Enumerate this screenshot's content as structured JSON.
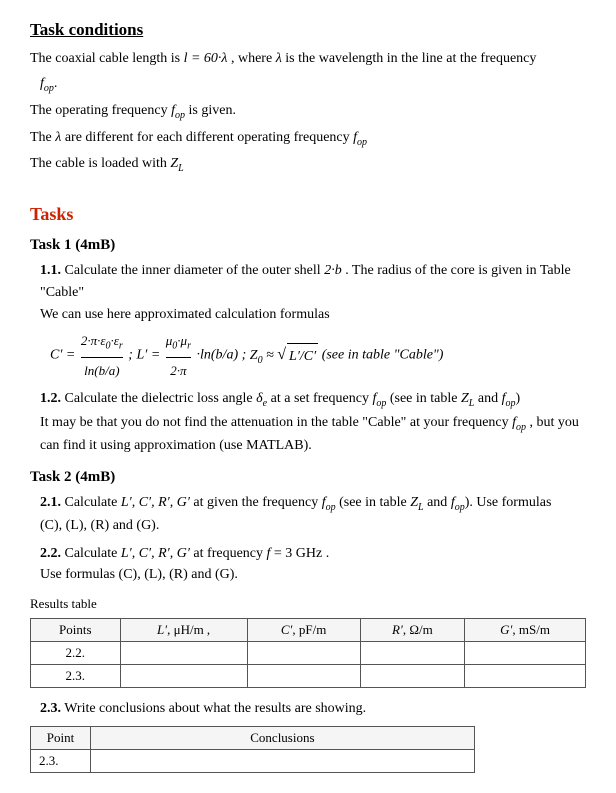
{
  "title": "Task conditions",
  "intro": {
    "line1": "The coaxial cable length is",
    "line1_formula": "l = 60·λ",
    "line1_cont": ", where",
    "line1_lambda": "λ",
    "line1_cont2": "is the wavelength in the line at the frequency",
    "line1_freq": "f",
    "line1_sub": "op",
    "line1_end": ".",
    "line2": "The operating frequency",
    "line2_f": "f",
    "line2_sub": "op",
    "line2_cont": "is given.",
    "line3_start": "The",
    "line3_lambda": "λ",
    "line3_cont": "are different for each different operating frequency",
    "line3_f": "f",
    "line3_sub": "op",
    "line4": "The cable is loaded with",
    "line4_Z": "Z",
    "line4_sub": "L"
  },
  "tasks_heading": "Tasks",
  "task1": {
    "title": "Task 1 (4mB)",
    "sub1": {
      "label": "1.1.",
      "text1": "Calculate the inner diameter of the outer shell",
      "formula1": "2·b",
      "text2": ". The radius of the core is given in Table \"Cable\"",
      "text3": "We can use here approximated calculation formulas",
      "formula_C": "C′ =",
      "formula_C_num": "2·π·ε₀·εᵣ",
      "formula_C_den": "ln(b/a)",
      "formula_L": "L′ =",
      "formula_L_num": "μ₀·μᵣ",
      "formula_L_den": "2·π",
      "formula_L_end": "·ln(b/a)",
      "formula_Z": "Z₀ ≈",
      "formula_Z_sq": "L′/C′",
      "formula_Z_end": "(see in table \"Cable\")"
    },
    "sub2": {
      "label": "1.2.",
      "text1": "Calculate the dielectric loss angle",
      "delta": "δ",
      "sub_e": "e",
      "text2": "at a set frequency",
      "f_label": "f",
      "f_sub": "op",
      "text3": "(see in table",
      "Z_label": "Z",
      "Z_sub": "L",
      "text4": "and",
      "f2_label": "f",
      "f2_sub": "op",
      "text5": ")",
      "text6": "It may be that you do not find the attenuation in the table \"Cable\" at your frequency",
      "f3_label": "f",
      "f3_sub": "op",
      "text7": ", but you",
      "text8": "can find it using approximation (use MATLAB)."
    }
  },
  "task2": {
    "title": "Task 2 (4mB)",
    "sub1": {
      "label": "2.1.",
      "text1": "Calculate",
      "params": "L′, C′, R′, G′",
      "text2": "at given the frequency",
      "f_label": "f",
      "f_sub": "op",
      "text3": "(see in table",
      "Z_label": "Z",
      "Z_sub": "L",
      "text4": "and",
      "f2_label": "f",
      "f2_sub": "op",
      "text5": "). Use formulas",
      "text6": "(C), (L), (R) and (G)."
    },
    "sub2": {
      "label": "2.2.",
      "text1": "Calculate",
      "params": "L′, C′, R′, G′",
      "text2": "at frequency",
      "f_val": "f = 3 GHz",
      "text3": ".",
      "text4": "Use formulas (C), (L), (R) and (G)."
    },
    "results_label": "Results table",
    "table": {
      "headers": [
        "Points",
        "L′, μH/m ,",
        "C′, pF/m",
        "R′, Ω/m",
        "G′, mS/m"
      ],
      "rows": [
        [
          "2.2.",
          "",
          "",
          "",
          ""
        ],
        [
          "2.3.",
          "",
          "",
          "",
          ""
        ]
      ]
    },
    "sub3": {
      "label": "2.3.",
      "text1": "Write conclusions about what the results are showing."
    },
    "conclusions_table": {
      "headers": [
        "Point",
        "Conclusions"
      ],
      "rows": [
        [
          "2.3.",
          ""
        ]
      ]
    }
  }
}
